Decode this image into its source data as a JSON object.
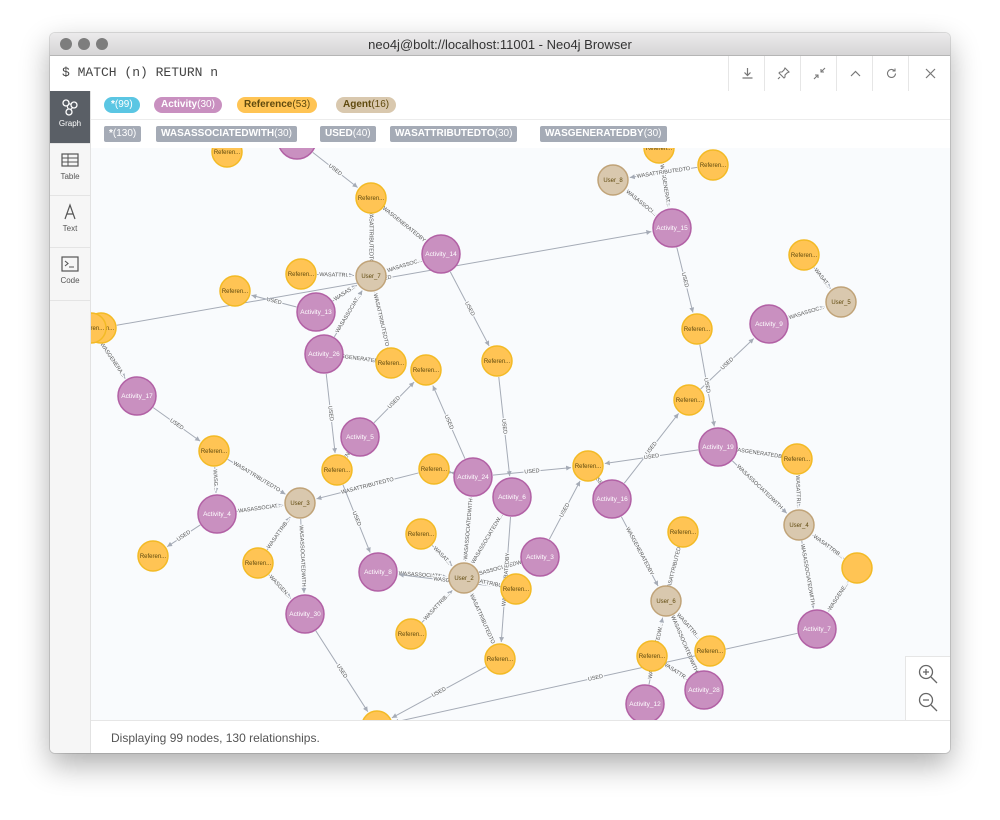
{
  "window": {
    "title": "neo4j@bolt://localhost:11001 - Neo4j Browser"
  },
  "command": {
    "text": "$ MATCH (n) RETURN n"
  },
  "toolbar": [
    "download-icon",
    "pin-icon",
    "collapse-icon",
    "chevron-up-icon",
    "refresh-icon",
    "close-icon"
  ],
  "sidebar": [
    {
      "label": "Graph",
      "icon": "graph-icon",
      "active": true
    },
    {
      "label": "Table",
      "icon": "table-icon",
      "active": false
    },
    {
      "label": "Text",
      "icon": "text-icon",
      "active": false
    },
    {
      "label": "Code",
      "icon": "code-icon",
      "active": false
    }
  ],
  "labels": [
    {
      "name": "*",
      "count": "(99)",
      "color": "#5bc6e3",
      "text": "#ffffff"
    },
    {
      "name": "Activity",
      "count": "(30)",
      "color": "#c990c0",
      "text": "#ffffff"
    },
    {
      "name": "Reference",
      "count": "(53)",
      "color": "#ffc454",
      "text": "#604a0e"
    },
    {
      "name": "Agent",
      "count": "(16)",
      "color": "#d9c8ae",
      "text": "#604a0e"
    }
  ],
  "relationships": [
    {
      "name": "*",
      "count": "(130)"
    },
    {
      "name": "WASASSOCIATEDWITH",
      "count": "(30)"
    },
    {
      "name": "USED",
      "count": "(40)"
    },
    {
      "name": "WASATTRIBUTEDTO",
      "count": "(30)"
    },
    {
      "name": "WASGENERATEDBY",
      "count": "(30)"
    }
  ],
  "colors": {
    "activity": "#c990c0",
    "activity_stroke": "#b261a5",
    "reference": "#ffc454",
    "reference_stroke": "#f3ba25",
    "agent": "#d9c8ae",
    "agent_stroke": "#c0a378",
    "edge": "#a5abb6"
  },
  "graph": {
    "nodes": [
      {
        "id": "a17",
        "type": "activity",
        "label": "Activity_17"
      },
      {
        "id": "a13",
        "type": "activity",
        "label": "Activity_13"
      },
      {
        "id": "a26",
        "type": "activity",
        "label": "Activity_26"
      },
      {
        "id": "a14",
        "type": "activity",
        "label": "Activity_14"
      },
      {
        "id": "a15",
        "type": "activity",
        "label": "Activity_15"
      },
      {
        "id": "a9",
        "type": "activity",
        "label": "Activity_9"
      },
      {
        "id": "a5",
        "type": "activity",
        "label": "Activity_5"
      },
      {
        "id": "a24",
        "type": "activity",
        "label": "Activity_24"
      },
      {
        "id": "a6",
        "type": "activity",
        "label": "Activity_6"
      },
      {
        "id": "a16",
        "type": "activity",
        "label": "Activity_16"
      },
      {
        "id": "a19",
        "type": "activity",
        "label": "Activity_19"
      },
      {
        "id": "a4",
        "type": "activity",
        "label": "Activity_4"
      },
      {
        "id": "a8",
        "type": "activity",
        "label": "Activity_8"
      },
      {
        "id": "a3",
        "type": "activity",
        "label": "Activity_3"
      },
      {
        "id": "a30",
        "type": "activity",
        "label": "Activity_30"
      },
      {
        "id": "a7",
        "type": "activity",
        "label": "Activity_7"
      },
      {
        "id": "a12",
        "type": "activity",
        "label": "Activity_12"
      },
      {
        "id": "a28",
        "type": "activity",
        "label": "Activity_28"
      },
      {
        "id": "aTop",
        "type": "activity",
        "label": ""
      },
      {
        "id": "u8",
        "type": "agent",
        "label": "User_8"
      },
      {
        "id": "u7",
        "type": "agent",
        "label": "User_7"
      },
      {
        "id": "u5",
        "type": "agent",
        "label": "User_5"
      },
      {
        "id": "u3",
        "type": "agent",
        "label": "User_3"
      },
      {
        "id": "u2",
        "type": "agent",
        "label": "User_2"
      },
      {
        "id": "u4",
        "type": "agent",
        "label": "User_4"
      },
      {
        "id": "u6",
        "type": "agent",
        "label": "User_6"
      },
      {
        "id": "r1",
        "type": "reference",
        "label": "Referen..."
      },
      {
        "id": "r2",
        "type": "reference",
        "label": "Referen..."
      },
      {
        "id": "r3",
        "type": "reference",
        "label": "Referen..."
      },
      {
        "id": "r4",
        "type": "reference",
        "label": "Referen..."
      },
      {
        "id": "r5",
        "type": "reference",
        "label": "Referen..."
      },
      {
        "id": "r6",
        "type": "reference",
        "label": "Referen..."
      },
      {
        "id": "r7",
        "type": "reference",
        "label": "Referen..."
      },
      {
        "id": "r8",
        "type": "reference",
        "label": "Referen..."
      },
      {
        "id": "r9",
        "type": "reference",
        "label": "Referen..."
      },
      {
        "id": "r10",
        "type": "reference",
        "label": "Referen..."
      },
      {
        "id": "r11",
        "type": "reference",
        "label": "Referen..."
      },
      {
        "id": "r12",
        "type": "reference",
        "label": "Referen..."
      },
      {
        "id": "r13",
        "type": "reference",
        "label": "Referen..."
      },
      {
        "id": "r14",
        "type": "reference",
        "label": "Referen..."
      },
      {
        "id": "r15",
        "type": "reference",
        "label": "Referen..."
      },
      {
        "id": "r16",
        "type": "reference",
        "label": "Referen..."
      },
      {
        "id": "r17",
        "type": "reference",
        "label": "Referen..."
      },
      {
        "id": "r18",
        "type": "reference",
        "label": "Referen..."
      },
      {
        "id": "r19",
        "type": "reference",
        "label": "Referen..."
      },
      {
        "id": "r20",
        "type": "reference",
        "label": "Referen..."
      },
      {
        "id": "r21",
        "type": "reference",
        "label": "Referen..."
      },
      {
        "id": "r22",
        "type": "reference",
        "label": "Referen..."
      },
      {
        "id": "r23",
        "type": "reference",
        "label": "Referen..."
      },
      {
        "id": "r24",
        "type": "reference",
        "label": "Referen..."
      },
      {
        "id": "r25",
        "type": "reference",
        "label": "Referen..."
      },
      {
        "id": "r26",
        "type": "reference",
        "label": "Referen..."
      },
      {
        "id": "r27",
        "type": "reference",
        "label": "Referen..."
      },
      {
        "id": "r28",
        "type": "reference",
        "label": "Referen..."
      },
      {
        "id": "r29",
        "type": "reference",
        "label": ""
      },
      {
        "id": "r30",
        "type": "reference",
        "label": ""
      }
    ],
    "edges": [
      {
        "from": "aTop",
        "to": "r2",
        "label": "USED"
      },
      {
        "from": "r2",
        "to": "a14",
        "label": "WASGENERATEDBY"
      },
      {
        "from": "r2",
        "to": "u7",
        "label": "WASATTRIBUTEDTO"
      },
      {
        "from": "a14",
        "to": "u7",
        "label": "WASASSOC..."
      },
      {
        "from": "r9",
        "to": "u7",
        "label": "WASATTRI..."
      },
      {
        "from": "a13",
        "to": "u7",
        "label": "WASAS..."
      },
      {
        "from": "a26",
        "to": "u7",
        "label": "WASASSOCIAT..."
      },
      {
        "from": "r14",
        "to": "u7",
        "label": "WASATTRIBUTEDTO"
      },
      {
        "from": "a13",
        "to": "r10",
        "label": "USED"
      },
      {
        "from": "a26",
        "to": "r14",
        "label": "WASGENERATEDBY"
      },
      {
        "from": "a14",
        "to": "r15",
        "label": "USED"
      },
      {
        "from": "r11",
        "to": "a17",
        "label": "WASGENERA..."
      },
      {
        "from": "a17",
        "to": "r16",
        "label": "USED"
      },
      {
        "from": "r16",
        "to": "u3",
        "label": "WASATTRIBUTEDTO"
      },
      {
        "from": "r16",
        "to": "a4",
        "label": "WASG..."
      },
      {
        "from": "a4",
        "to": "u3",
        "label": "WASASSOCIAT..."
      },
      {
        "from": "a4",
        "to": "r26",
        "label": "USED"
      },
      {
        "from": "r27",
        "to": "u3",
        "label": "WASATTRIB..."
      },
      {
        "from": "u3",
        "to": "a30",
        "label": "WASASSOCIATEDWITH"
      },
      {
        "from": "r27",
        "to": "a30",
        "label": "WASGEN..."
      },
      {
        "from": "a30",
        "to": "r30",
        "label": "USED"
      },
      {
        "from": "r18",
        "to": "u3",
        "label": "WASATTRIBUTEDTO"
      },
      {
        "from": "a26",
        "to": "r17",
        "label": "USED"
      },
      {
        "from": "a5",
        "to": "r13",
        "label": "USED"
      },
      {
        "from": "r17",
        "to": "a5",
        "label": "WASGENERAT..."
      },
      {
        "from": "a24",
        "to": "r18",
        "label": "WASGENERATEDBY"
      },
      {
        "from": "a24",
        "to": "r19",
        "label": "USED"
      },
      {
        "from": "a24",
        "to": "r13",
        "label": "USED"
      },
      {
        "from": "r17",
        "to": "a8",
        "label": "USED"
      },
      {
        "from": "a8",
        "to": "u2",
        "label": "WASASSOCIATE..."
      },
      {
        "from": "r24",
        "to": "a8",
        "label": "WASGENE..."
      },
      {
        "from": "r24",
        "to": "u2",
        "label": "WASATTRIBUTE..."
      },
      {
        "from": "r20",
        "to": "u2",
        "label": "WASAT..."
      },
      {
        "from": "a24",
        "to": "u2",
        "label": "WASASSOCIATEDWITH"
      },
      {
        "from": "a6",
        "to": "u2",
        "label": "WASASSOCIATEDW..."
      },
      {
        "from": "a3",
        "to": "u2",
        "label": "WASASSOCIATEDWITH"
      },
      {
        "from": "r25",
        "to": "u2",
        "label": "WASATTRIBUTEDTO"
      },
      {
        "from": "r18",
        "to": "a24",
        "label": "WASGENERATEDBY"
      },
      {
        "from": "a6",
        "to": "r25",
        "label": "WASGENERATEDBY"
      },
      {
        "from": "a3",
        "to": "r19",
        "label": "USED"
      },
      {
        "from": "r15",
        "to": "a6",
        "label": "USED"
      },
      {
        "from": "a16",
        "to": "r19",
        "label": "USED"
      },
      {
        "from": "a16",
        "to": "r8",
        "label": "USED"
      },
      {
        "from": "r21",
        "to": "u2",
        "label": "WASATTRIB..."
      },
      {
        "from": "r25",
        "to": "r30",
        "label": "USED"
      },
      {
        "from": "a16",
        "to": "u6",
        "label": "WASGENERATEDBY"
      },
      {
        "from": "r22",
        "to": "u6",
        "label": "WASATTRIBUTEDTO"
      },
      {
        "from": "a12",
        "to": "u6",
        "label": "WASASSOCIATEDW..."
      },
      {
        "from": "a28",
        "to": "u6",
        "label": "WASASSOCIATEDWITH"
      },
      {
        "from": "r23",
        "to": "u6",
        "label": "WASATTRI..."
      },
      {
        "from": "r28",
        "to": "a28",
        "label": "WASATTR..."
      },
      {
        "from": "a19",
        "to": "r19",
        "label": "USED"
      },
      {
        "from": "a19",
        "to": "r12",
        "label": "WASGENERATEDBY"
      },
      {
        "from": "a19",
        "to": "u4",
        "label": "WASASSOCIATEDWITH"
      },
      {
        "from": "r12",
        "to": "u4",
        "label": "WASATTRI..."
      },
      {
        "from": "u4",
        "to": "a7",
        "label": "WASASSOCIATEDWITH"
      },
      {
        "from": "r29",
        "to": "a7",
        "label": "WASGENE..."
      },
      {
        "from": "r29",
        "to": "u4",
        "label": "WASATTRIB..."
      },
      {
        "from": "a7",
        "to": "r30",
        "label": "USED"
      },
      {
        "from": "r8",
        "to": "a9",
        "label": "USED"
      },
      {
        "from": "a9",
        "to": "u5",
        "label": "WASASSOC..."
      },
      {
        "from": "r7",
        "to": "u5",
        "label": "WASAT..."
      },
      {
        "from": "a15",
        "to": "r6",
        "label": "USED"
      },
      {
        "from": "a15",
        "to": "u8",
        "label": "WASASSOCI..."
      },
      {
        "from": "r4",
        "to": "a15",
        "label": "WASGENERAT..."
      },
      {
        "from": "r5",
        "to": "a15",
        "label": "USED"
      },
      {
        "from": "r6",
        "to": "a19",
        "label": "USED"
      },
      {
        "from": "r3",
        "to": "u8",
        "label": "WASATTRIBUTEDTO"
      }
    ]
  },
  "footer": {
    "text": "Displaying 99 nodes, 130 relationships."
  }
}
